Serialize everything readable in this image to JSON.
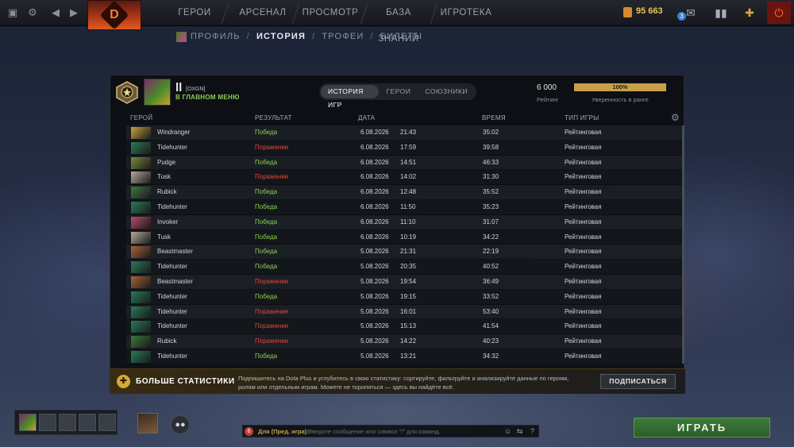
{
  "topbar": {
    "nav": [
      "ГЕРОИ",
      "АРСЕНАЛ",
      "ПРОСМОТР",
      "БАЗА ЗНАНИЙ",
      "ИГРОТЕКА"
    ],
    "gold": "95 663",
    "notification_count": "3"
  },
  "subnav": {
    "items": [
      "ПРОФИЛЬ",
      "ИСТОРИЯ",
      "ТРОФЕИ",
      "БИЛЕТЫ"
    ],
    "active": "ИСТОРИЯ"
  },
  "player": {
    "name": "ll",
    "tag": "[OXGN]",
    "status": "В ГЛАВНОМ МЕНЮ"
  },
  "tabs": [
    "ИСТОРИЯ ИГР",
    "ГЕРОИ",
    "СОЮЗНИКИ"
  ],
  "rating": {
    "value": "6 000",
    "label": "Рейтинг",
    "confidence": "100%",
    "confidence_label": "Уверенность в ранге"
  },
  "columns": {
    "hero": "ГЕРОЙ",
    "result": "РЕЗУЛЬТАТ",
    "date": "ДАТА",
    "time": "ВРЕМЯ",
    "game_type": "ТИП ИГРЫ"
  },
  "matches": [
    {
      "hero": "Windranger",
      "result": "Победа",
      "win": true,
      "date": "6.08.2026",
      "clock": "21:43",
      "duration": "35:02",
      "type": "Рейтинговая",
      "color": "#c8a040"
    },
    {
      "hero": "Tidehunter",
      "result": "Поражение",
      "win": false,
      "date": "6.08.2026",
      "clock": "17:59",
      "duration": "39:58",
      "type": "Рейтинговая",
      "color": "#2a7a5a"
    },
    {
      "hero": "Pudge",
      "result": "Победа",
      "win": true,
      "date": "6.08.2026",
      "clock": "14:51",
      "duration": "46:33",
      "type": "Рейтинговая",
      "color": "#7a8a3a"
    },
    {
      "hero": "Tusk",
      "result": "Поражение",
      "win": false,
      "date": "6.08.2026",
      "clock": "14:02",
      "duration": "31:30",
      "type": "Рейтинговая",
      "color": "#b8a898"
    },
    {
      "hero": "Rubick",
      "result": "Победа",
      "win": true,
      "date": "6.08.2026",
      "clock": "12:48",
      "duration": "35:52",
      "type": "Рейтинговая",
      "color": "#3a7a3a"
    },
    {
      "hero": "Tidehunter",
      "result": "Победа",
      "win": true,
      "date": "6.08.2026",
      "clock": "11:50",
      "duration": "35:23",
      "type": "Рейтинговая",
      "color": "#2a7a5a"
    },
    {
      "hero": "Invoker",
      "result": "Победа",
      "win": true,
      "date": "6.08.2026",
      "clock": "11:10",
      "duration": "31:07",
      "type": "Рейтинговая",
      "color": "#b84a6a"
    },
    {
      "hero": "Tusk",
      "result": "Победа",
      "win": true,
      "date": "6.08.2026",
      "clock": "10:19",
      "duration": "34:22",
      "type": "Рейтинговая",
      "color": "#b8a898"
    },
    {
      "hero": "Beastmaster",
      "result": "Победа",
      "win": true,
      "date": "5.08.2026",
      "clock": "21:31",
      "duration": "22:19",
      "type": "Рейтинговая",
      "color": "#a8623a"
    },
    {
      "hero": "Tidehunter",
      "result": "Победа",
      "win": true,
      "date": "5.08.2026",
      "clock": "20:35",
      "duration": "40:52",
      "type": "Рейтинговая",
      "color": "#2a7a5a"
    },
    {
      "hero": "Beastmaster",
      "result": "Поражение",
      "win": false,
      "date": "5.08.2026",
      "clock": "19:54",
      "duration": "36:49",
      "type": "Рейтинговая",
      "color": "#a8623a"
    },
    {
      "hero": "Tidehunter",
      "result": "Победа",
      "win": true,
      "date": "5.08.2026",
      "clock": "19:15",
      "duration": "33:52",
      "type": "Рейтинговая",
      "color": "#2a7a5a"
    },
    {
      "hero": "Tidehunter",
      "result": "Поражение",
      "win": false,
      "date": "5.08.2026",
      "clock": "16:01",
      "duration": "53:40",
      "type": "Рейтинговая",
      "color": "#2a7a5a"
    },
    {
      "hero": "Tidehunter",
      "result": "Поражение",
      "win": false,
      "date": "5.08.2026",
      "clock": "15:13",
      "duration": "41:54",
      "type": "Рейтинговая",
      "color": "#2a7a5a"
    },
    {
      "hero": "Rubick",
      "result": "Поражение",
      "win": false,
      "date": "5.08.2026",
      "clock": "14:22",
      "duration": "40:23",
      "type": "Рейтинговая",
      "color": "#3a7a3a"
    },
    {
      "hero": "Tidehunter",
      "result": "Победа",
      "win": true,
      "date": "5.08.2026",
      "clock": "13:21",
      "duration": "34:32",
      "type": "Рейтинговая",
      "color": "#2a7a5a"
    }
  ],
  "upsell": {
    "title": "БОЛЬШЕ СТАТИСТИКИ",
    "text": "Подпишитесь на Dota Plus и углубитесь в свою статистику: сортируйте, фильтруйте и анализируйте данные по героям, ролям или отдельным играм. Можете не торопиться — здесь вы найдёте всё.",
    "button": "ПОДПИСАТЬСЯ"
  },
  "chat": {
    "badge": "6",
    "channel": "Для (Пред. игра):",
    "placeholder": "Введите сообщение или символ \"/\" для команд."
  },
  "play_button": "ИГРАТЬ",
  "colors": {
    "win": "#8fd14f",
    "loss": "#e0483a",
    "accent_gold": "#c8a048"
  }
}
